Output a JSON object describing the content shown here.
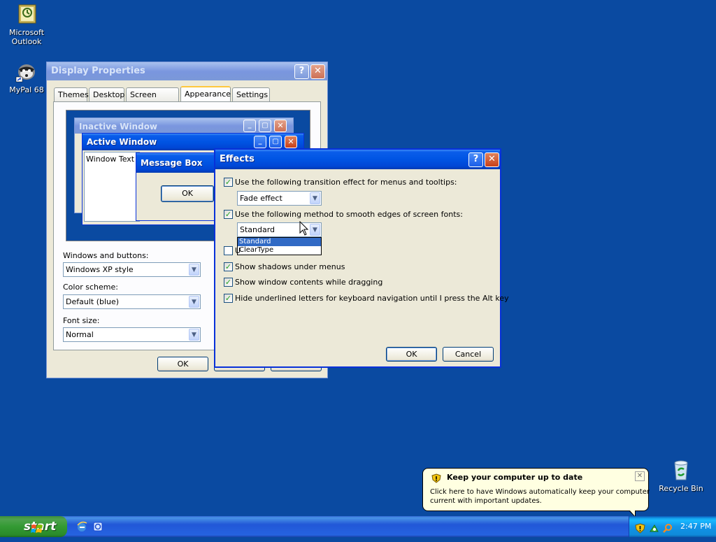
{
  "desktop": {
    "icons": [
      {
        "label_line1": "Microsoft",
        "label_line2": "Outlook",
        "icon": "outlook-icon"
      },
      {
        "label_line1": "MyPal 68",
        "label_line2": "",
        "icon": "mypal-icon"
      },
      {
        "label_line1": "Recycle Bin",
        "label_line2": "",
        "icon": "recycle-bin-icon"
      }
    ]
  },
  "display_properties": {
    "title": "Display Properties",
    "tabs": [
      "Themes",
      "Desktop",
      "Screen Saver",
      "Appearance",
      "Settings"
    ],
    "preview": {
      "inactive_title": "Inactive Window",
      "active_title": "Active Window",
      "window_text": "Window Text",
      "message_box_title": "Message Box",
      "message_box_ok": "OK"
    },
    "windows_and_buttons_label": "Windows and buttons:",
    "windows_and_buttons_value": "Windows XP style",
    "color_scheme_label": "Color scheme:",
    "color_scheme_value": "Default (blue)",
    "font_size_label": "Font size:",
    "font_size_value": "Normal",
    "ok_label": "OK"
  },
  "effects": {
    "title": "Effects",
    "transition_label": "Use the following transition effect for menus and tooltips:",
    "transition_value": "Fade effect",
    "smooth_label": "Use the following method to smooth edges of screen fonts:",
    "smooth_value": "Standard",
    "smooth_options": [
      "Standard",
      "ClearType"
    ],
    "large_icons_prefix": "U",
    "shadows_label": "Show shadows under menus",
    "drag_label": "Show window contents while dragging",
    "underline_label": "Hide underlined letters for keyboard navigation until I press the Alt key",
    "ok_label": "OK",
    "cancel_label": "Cancel"
  },
  "balloon": {
    "title": "Keep your computer up to date",
    "body_line1": "Click here to have Windows automatically keep your computer",
    "body_line2": "current with important updates."
  },
  "taskbar": {
    "start_label": "start",
    "clock": "2:47 PM"
  },
  "colors": {
    "desktop": "#0a4aa1",
    "title_active": "#0054e3",
    "dialog_face": "#ece9d8",
    "balloon": "#ffffe1",
    "start_green": "#339a33"
  }
}
